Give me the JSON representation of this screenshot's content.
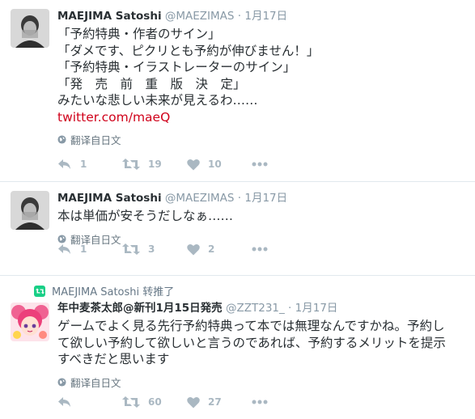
{
  "tweets": [
    {
      "name": "MAEJIMA Satoshi",
      "handle": "@MAEZIMAS",
      "dot": "·",
      "time": "1月17日",
      "lines": [
        "「予約特典・作者のサイン」",
        "「ダメです、ピクリとも予約が伸びません！」",
        "「予約特典・イラストレーターのサイン」",
        "「発　売　前　重　版　決　定」",
        "みたいな悲しい未来が見えるわ……"
      ],
      "link": "twitter.com/maeQ",
      "translate": "翻译自日文",
      "retweets": "19",
      "likes": "10",
      "replies": "1"
    },
    {
      "name": "MAEJIMA Satoshi",
      "handle": "@MAEZIMAS",
      "dot": "·",
      "time": "1月17日",
      "lines": [
        "本は単価が安そうだしなぁ……"
      ],
      "translate": "翻译自日文",
      "retweets": "3",
      "likes": "2",
      "replies": "1"
    },
    {
      "retweeted_by": "MAEJIMA Satoshi 转推了",
      "name": "年中麦茶太郎@新刊1月15日発売",
      "handle": "@ZZT231_",
      "dot": "·",
      "time": "1月17日",
      "lines": [
        "ゲームでよく見る先行予約特典って本では無理なんですかね。予約し",
        "て欲しい予約して欲しいと言うのであれば、予約するメリットを提示",
        "すべきだと思います"
      ],
      "translate": "翻译自日文",
      "retweets": "60",
      "likes": "27"
    }
  ],
  "colors": {
    "link": "#d0021b",
    "retweet_badge": "#19cf86",
    "action_gray": "#aab8c2",
    "meta_gray": "#8899a6"
  },
  "icons": {
    "reply": "reply-icon",
    "retweet": "retweet-icon",
    "like": "heart-icon",
    "more": "more-dots-icon",
    "translate": "globe-icon"
  }
}
